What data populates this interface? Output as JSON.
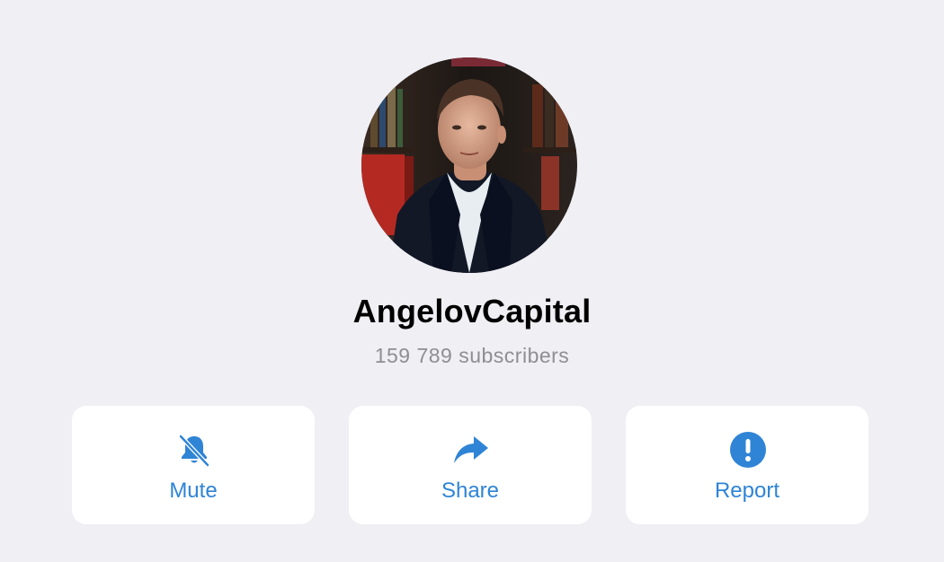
{
  "channel": {
    "name": "AngelovCapital",
    "subscribers": "159 789 subscribers"
  },
  "actions": [
    {
      "label": "Mute",
      "icon": "bell-slash-icon"
    },
    {
      "label": "Share",
      "icon": "share-arrow-icon"
    },
    {
      "label": "Report",
      "icon": "exclamation-circle-icon"
    }
  ],
  "colors": {
    "background": "#efeff4",
    "card": "#ffffff",
    "accent": "#2f84d6",
    "secondary_text": "#8e8e93"
  }
}
